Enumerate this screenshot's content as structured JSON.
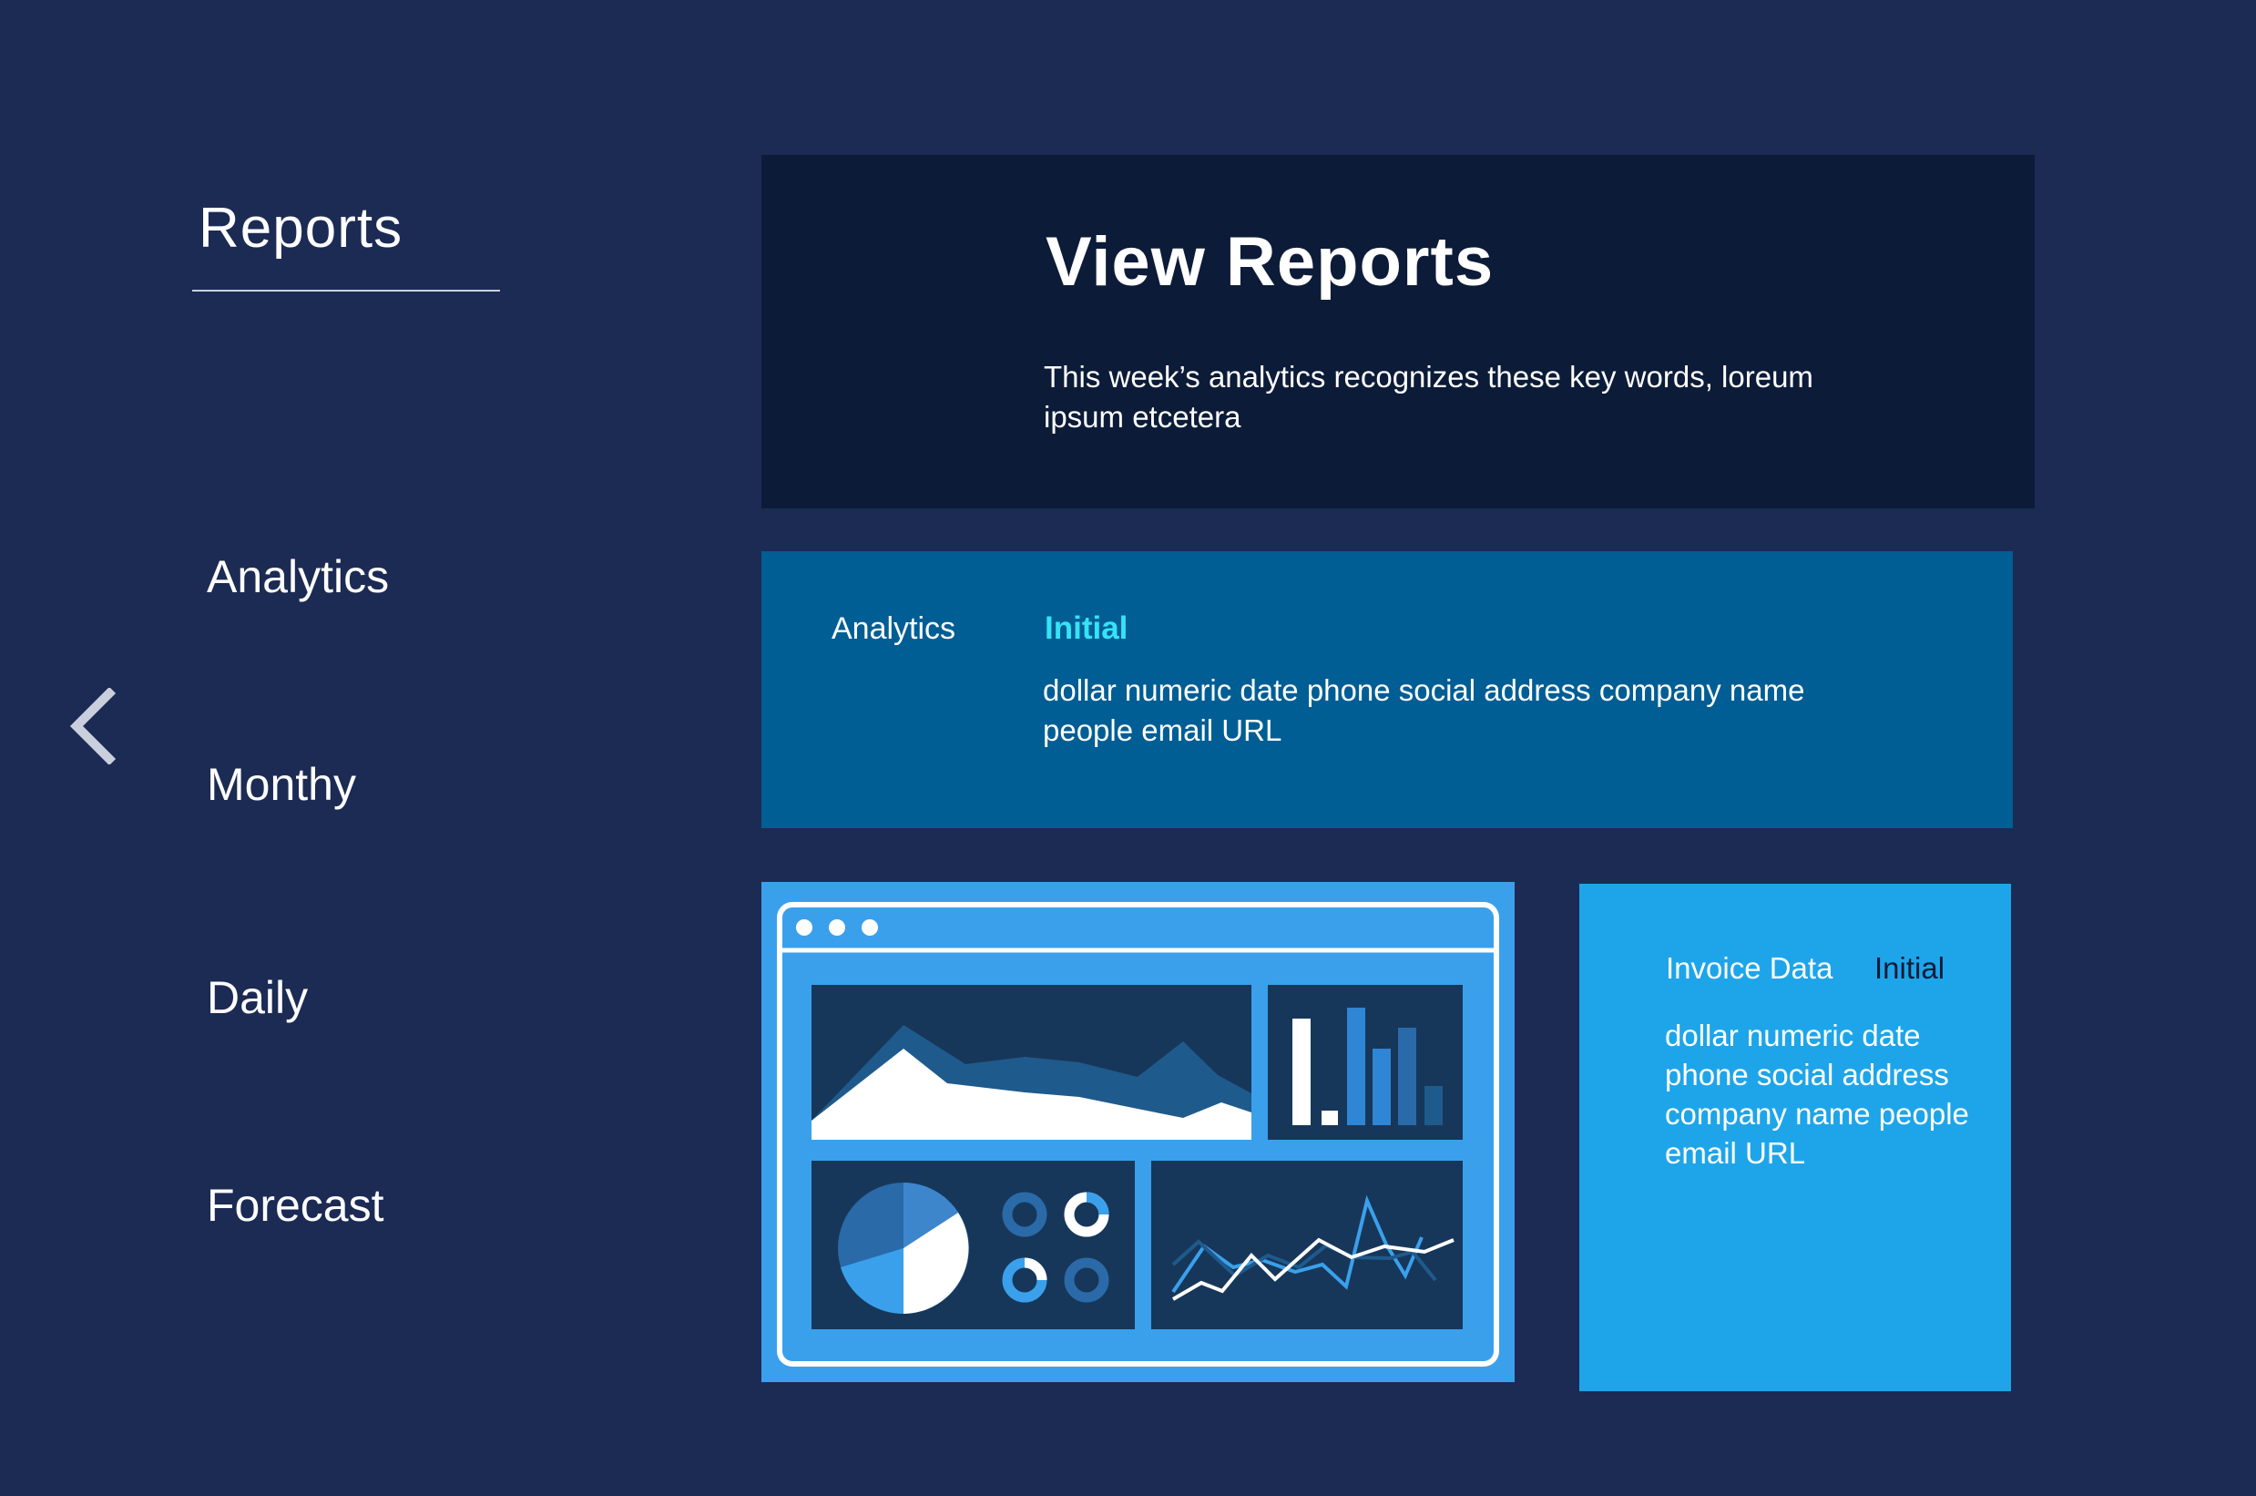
{
  "sidebar": {
    "title": "Reports",
    "items": [
      {
        "label": "Analytics"
      },
      {
        "label": "Monthy"
      },
      {
        "label": "Daily"
      },
      {
        "label": "Forecast"
      }
    ]
  },
  "header": {
    "title": "View Reports",
    "description": "This week’s analytics recognizes these key words, loreum ipsum etcetera"
  },
  "analytics": {
    "label": "Analytics",
    "tag": "Initial",
    "keywords": "dollar numeric date phone social address company name people email URL"
  },
  "invoice": {
    "label": "Invoice Data",
    "tag": "Initial",
    "keywords": "dollar numeric date phone social address company name people email URL"
  },
  "icons": {
    "back": "chevron-left-icon",
    "illustration": "dashboard-illustration"
  },
  "colors": {
    "background": "#1c2b54",
    "header_panel": "#0c1b38",
    "analytics_panel": "#005e94",
    "analytics_tag": "#36e3f5",
    "illustration_bg": "#3aa0ec",
    "invoice_panel": "#1ea5e9",
    "invoice_tag": "#0a1a38"
  }
}
